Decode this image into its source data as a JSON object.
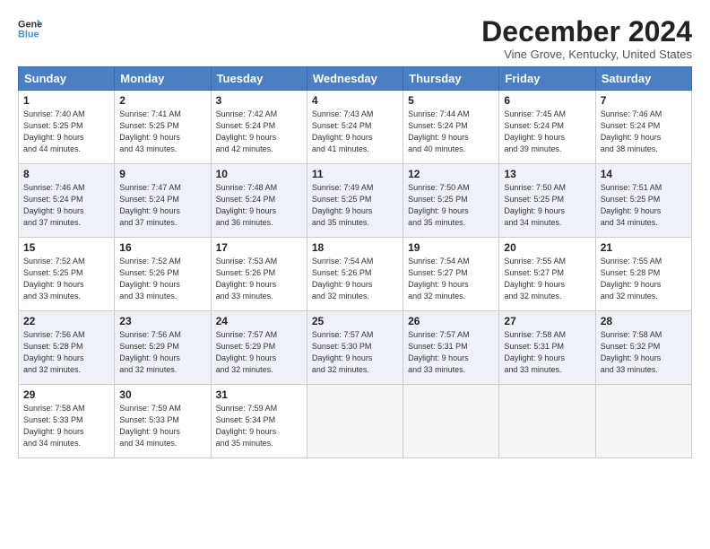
{
  "header": {
    "logo_line1": "General",
    "logo_line2": "Blue",
    "month_title": "December 2024",
    "location": "Vine Grove, Kentucky, United States"
  },
  "weekdays": [
    "Sunday",
    "Monday",
    "Tuesday",
    "Wednesday",
    "Thursday",
    "Friday",
    "Saturday"
  ],
  "weeks": [
    [
      {
        "day": 1,
        "info": "Sunrise: 7:40 AM\nSunset: 5:25 PM\nDaylight: 9 hours\nand 44 minutes."
      },
      {
        "day": 2,
        "info": "Sunrise: 7:41 AM\nSunset: 5:25 PM\nDaylight: 9 hours\nand 43 minutes."
      },
      {
        "day": 3,
        "info": "Sunrise: 7:42 AM\nSunset: 5:24 PM\nDaylight: 9 hours\nand 42 minutes."
      },
      {
        "day": 4,
        "info": "Sunrise: 7:43 AM\nSunset: 5:24 PM\nDaylight: 9 hours\nand 41 minutes."
      },
      {
        "day": 5,
        "info": "Sunrise: 7:44 AM\nSunset: 5:24 PM\nDaylight: 9 hours\nand 40 minutes."
      },
      {
        "day": 6,
        "info": "Sunrise: 7:45 AM\nSunset: 5:24 PM\nDaylight: 9 hours\nand 39 minutes."
      },
      {
        "day": 7,
        "info": "Sunrise: 7:46 AM\nSunset: 5:24 PM\nDaylight: 9 hours\nand 38 minutes."
      }
    ],
    [
      {
        "day": 8,
        "info": "Sunrise: 7:46 AM\nSunset: 5:24 PM\nDaylight: 9 hours\nand 37 minutes."
      },
      {
        "day": 9,
        "info": "Sunrise: 7:47 AM\nSunset: 5:24 PM\nDaylight: 9 hours\nand 37 minutes."
      },
      {
        "day": 10,
        "info": "Sunrise: 7:48 AM\nSunset: 5:24 PM\nDaylight: 9 hours\nand 36 minutes."
      },
      {
        "day": 11,
        "info": "Sunrise: 7:49 AM\nSunset: 5:25 PM\nDaylight: 9 hours\nand 35 minutes."
      },
      {
        "day": 12,
        "info": "Sunrise: 7:50 AM\nSunset: 5:25 PM\nDaylight: 9 hours\nand 35 minutes."
      },
      {
        "day": 13,
        "info": "Sunrise: 7:50 AM\nSunset: 5:25 PM\nDaylight: 9 hours\nand 34 minutes."
      },
      {
        "day": 14,
        "info": "Sunrise: 7:51 AM\nSunset: 5:25 PM\nDaylight: 9 hours\nand 34 minutes."
      }
    ],
    [
      {
        "day": 15,
        "info": "Sunrise: 7:52 AM\nSunset: 5:25 PM\nDaylight: 9 hours\nand 33 minutes."
      },
      {
        "day": 16,
        "info": "Sunrise: 7:52 AM\nSunset: 5:26 PM\nDaylight: 9 hours\nand 33 minutes."
      },
      {
        "day": 17,
        "info": "Sunrise: 7:53 AM\nSunset: 5:26 PM\nDaylight: 9 hours\nand 33 minutes."
      },
      {
        "day": 18,
        "info": "Sunrise: 7:54 AM\nSunset: 5:26 PM\nDaylight: 9 hours\nand 32 minutes."
      },
      {
        "day": 19,
        "info": "Sunrise: 7:54 AM\nSunset: 5:27 PM\nDaylight: 9 hours\nand 32 minutes."
      },
      {
        "day": 20,
        "info": "Sunrise: 7:55 AM\nSunset: 5:27 PM\nDaylight: 9 hours\nand 32 minutes."
      },
      {
        "day": 21,
        "info": "Sunrise: 7:55 AM\nSunset: 5:28 PM\nDaylight: 9 hours\nand 32 minutes."
      }
    ],
    [
      {
        "day": 22,
        "info": "Sunrise: 7:56 AM\nSunset: 5:28 PM\nDaylight: 9 hours\nand 32 minutes."
      },
      {
        "day": 23,
        "info": "Sunrise: 7:56 AM\nSunset: 5:29 PM\nDaylight: 9 hours\nand 32 minutes."
      },
      {
        "day": 24,
        "info": "Sunrise: 7:57 AM\nSunset: 5:29 PM\nDaylight: 9 hours\nand 32 minutes."
      },
      {
        "day": 25,
        "info": "Sunrise: 7:57 AM\nSunset: 5:30 PM\nDaylight: 9 hours\nand 32 minutes."
      },
      {
        "day": 26,
        "info": "Sunrise: 7:57 AM\nSunset: 5:31 PM\nDaylight: 9 hours\nand 33 minutes."
      },
      {
        "day": 27,
        "info": "Sunrise: 7:58 AM\nSunset: 5:31 PM\nDaylight: 9 hours\nand 33 minutes."
      },
      {
        "day": 28,
        "info": "Sunrise: 7:58 AM\nSunset: 5:32 PM\nDaylight: 9 hours\nand 33 minutes."
      }
    ],
    [
      {
        "day": 29,
        "info": "Sunrise: 7:58 AM\nSunset: 5:33 PM\nDaylight: 9 hours\nand 34 minutes."
      },
      {
        "day": 30,
        "info": "Sunrise: 7:59 AM\nSunset: 5:33 PM\nDaylight: 9 hours\nand 34 minutes."
      },
      {
        "day": 31,
        "info": "Sunrise: 7:59 AM\nSunset: 5:34 PM\nDaylight: 9 hours\nand 35 minutes."
      },
      null,
      null,
      null,
      null
    ]
  ]
}
